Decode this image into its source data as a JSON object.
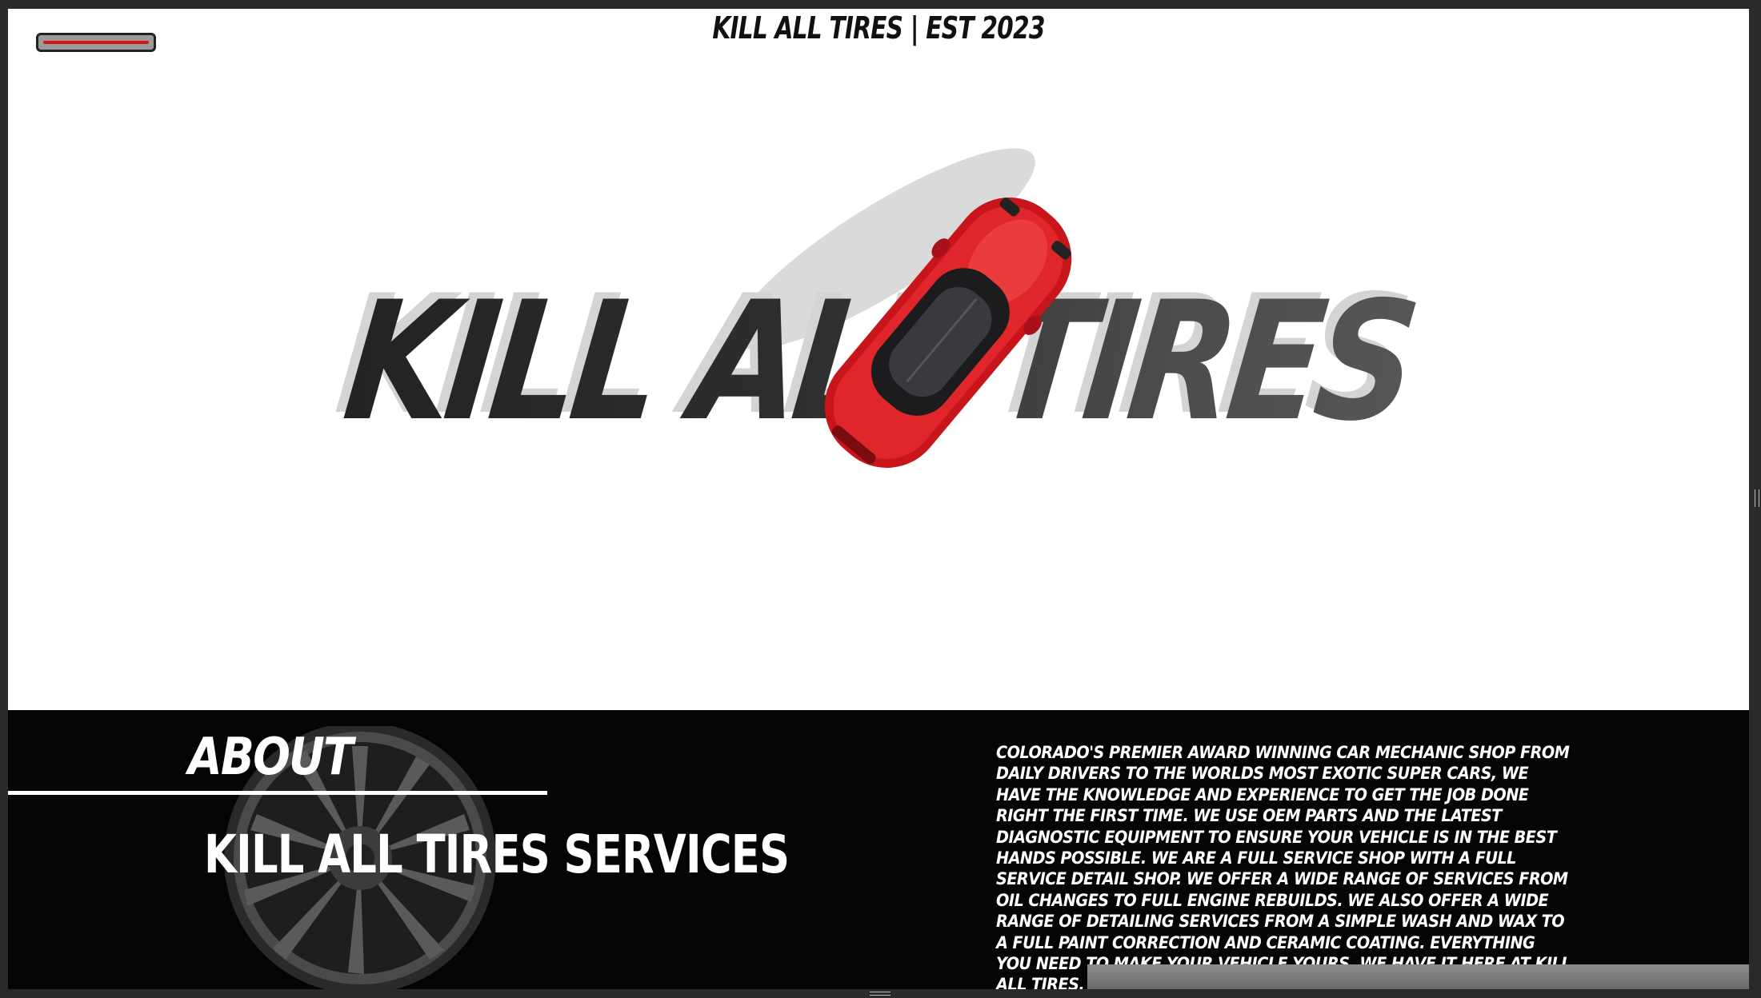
{
  "header": {
    "title": "KILL ALL TIRES | EST 2023",
    "menu_icon": "hamburger-icon"
  },
  "hero": {
    "title": "KILL ALL TIRES",
    "image": "red-sports-car-top-view"
  },
  "about": {
    "heading": "ABOUT",
    "subheading": "KILL ALL TIRES SERVICES",
    "body": "COLORADO'S PREMIER AWARD WINNING CAR MECHANIC SHOP FROM DAILY DRIVERS TO THE WORLDS MOST EXOTIC SUPER CARS, WE HAVE THE KNOWLEDGE AND EXPERIENCE TO GET THE JOB DONE RIGHT THE FIRST TIME. WE USE OEM PARTS AND THE LATEST DIAGNOSTIC EQUIPMENT TO ENSURE YOUR VEHICLE IS IN THE BEST HANDS POSSIBLE. WE ARE A FULL SERVICE SHOP WITH A FULL SERVICE DETAIL SHOP. WE OFFER A WIDE RANGE OF SERVICES FROM OIL CHANGES TO FULL ENGINE REBUILDS. WE ALSO OFFER A WIDE RANGE OF DETAILING SERVICES FROM A SIMPLE WASH AND WAX TO A FULL PAINT CORRECTION AND CERAMIC COATING. EVERYTHING YOU NEED TO MAKE YOUR VEHICLE YOURS, WE HAVE IT HERE AT KILL ALL TIRES.",
    "background_image": "alloy-wheel"
  },
  "colors": {
    "accent": "#d41414",
    "dark": "#050505",
    "light": "#ffffff"
  }
}
